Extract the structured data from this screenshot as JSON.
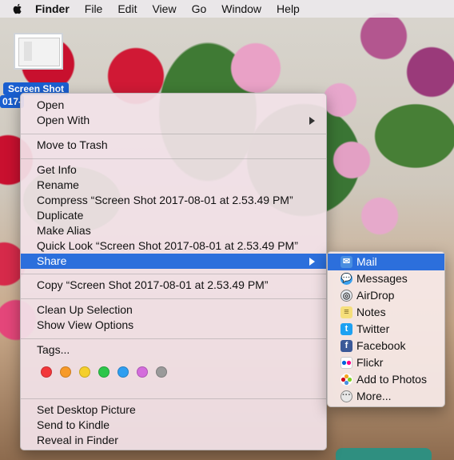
{
  "menubar": {
    "apple_icon": "apple-icon",
    "items": [
      "Finder",
      "File",
      "Edit",
      "View",
      "Go",
      "Window",
      "Help"
    ]
  },
  "desktop": {
    "file_label_line1": "Screen Shot",
    "file_label_line2": "017-"
  },
  "context_menu": {
    "open": "Open",
    "open_with": "Open With",
    "move_to_trash": "Move to Trash",
    "get_info": "Get Info",
    "rename": "Rename",
    "compress": "Compress “Screen Shot 2017-08-01 at 2.53.49 PM”",
    "duplicate": "Duplicate",
    "make_alias": "Make Alias",
    "quick_look": "Quick Look “Screen Shot 2017-08-01 at 2.53.49 PM”",
    "share": "Share",
    "copy": "Copy “Screen Shot 2017-08-01 at 2.53.49 PM”",
    "clean_up": "Clean Up Selection",
    "view_options": "Show View Options",
    "tags": "Tags...",
    "tag_colors": [
      "#f2373b",
      "#f79a29",
      "#f5cf2b",
      "#2dc64a",
      "#2f9ef0",
      "#d46cdc",
      "#9a9a9a"
    ],
    "set_desktop": "Set Desktop Picture",
    "send_kindle": "Send to Kindle",
    "reveal": "Reveal in Finder"
  },
  "share_menu": {
    "items": [
      {
        "label": "Mail",
        "icon": "mail-icon"
      },
      {
        "label": "Messages",
        "icon": "messages-icon"
      },
      {
        "label": "AirDrop",
        "icon": "airdrop-icon"
      },
      {
        "label": "Notes",
        "icon": "notes-icon"
      },
      {
        "label": "Twitter",
        "icon": "twitter-icon"
      },
      {
        "label": "Facebook",
        "icon": "facebook-icon"
      },
      {
        "label": "Flickr",
        "icon": "flickr-icon"
      },
      {
        "label": "Add to Photos",
        "icon": "photos-icon"
      },
      {
        "label": "More...",
        "icon": "more-icon"
      }
    ]
  },
  "colors": {
    "selection": "#2c6fdc"
  }
}
